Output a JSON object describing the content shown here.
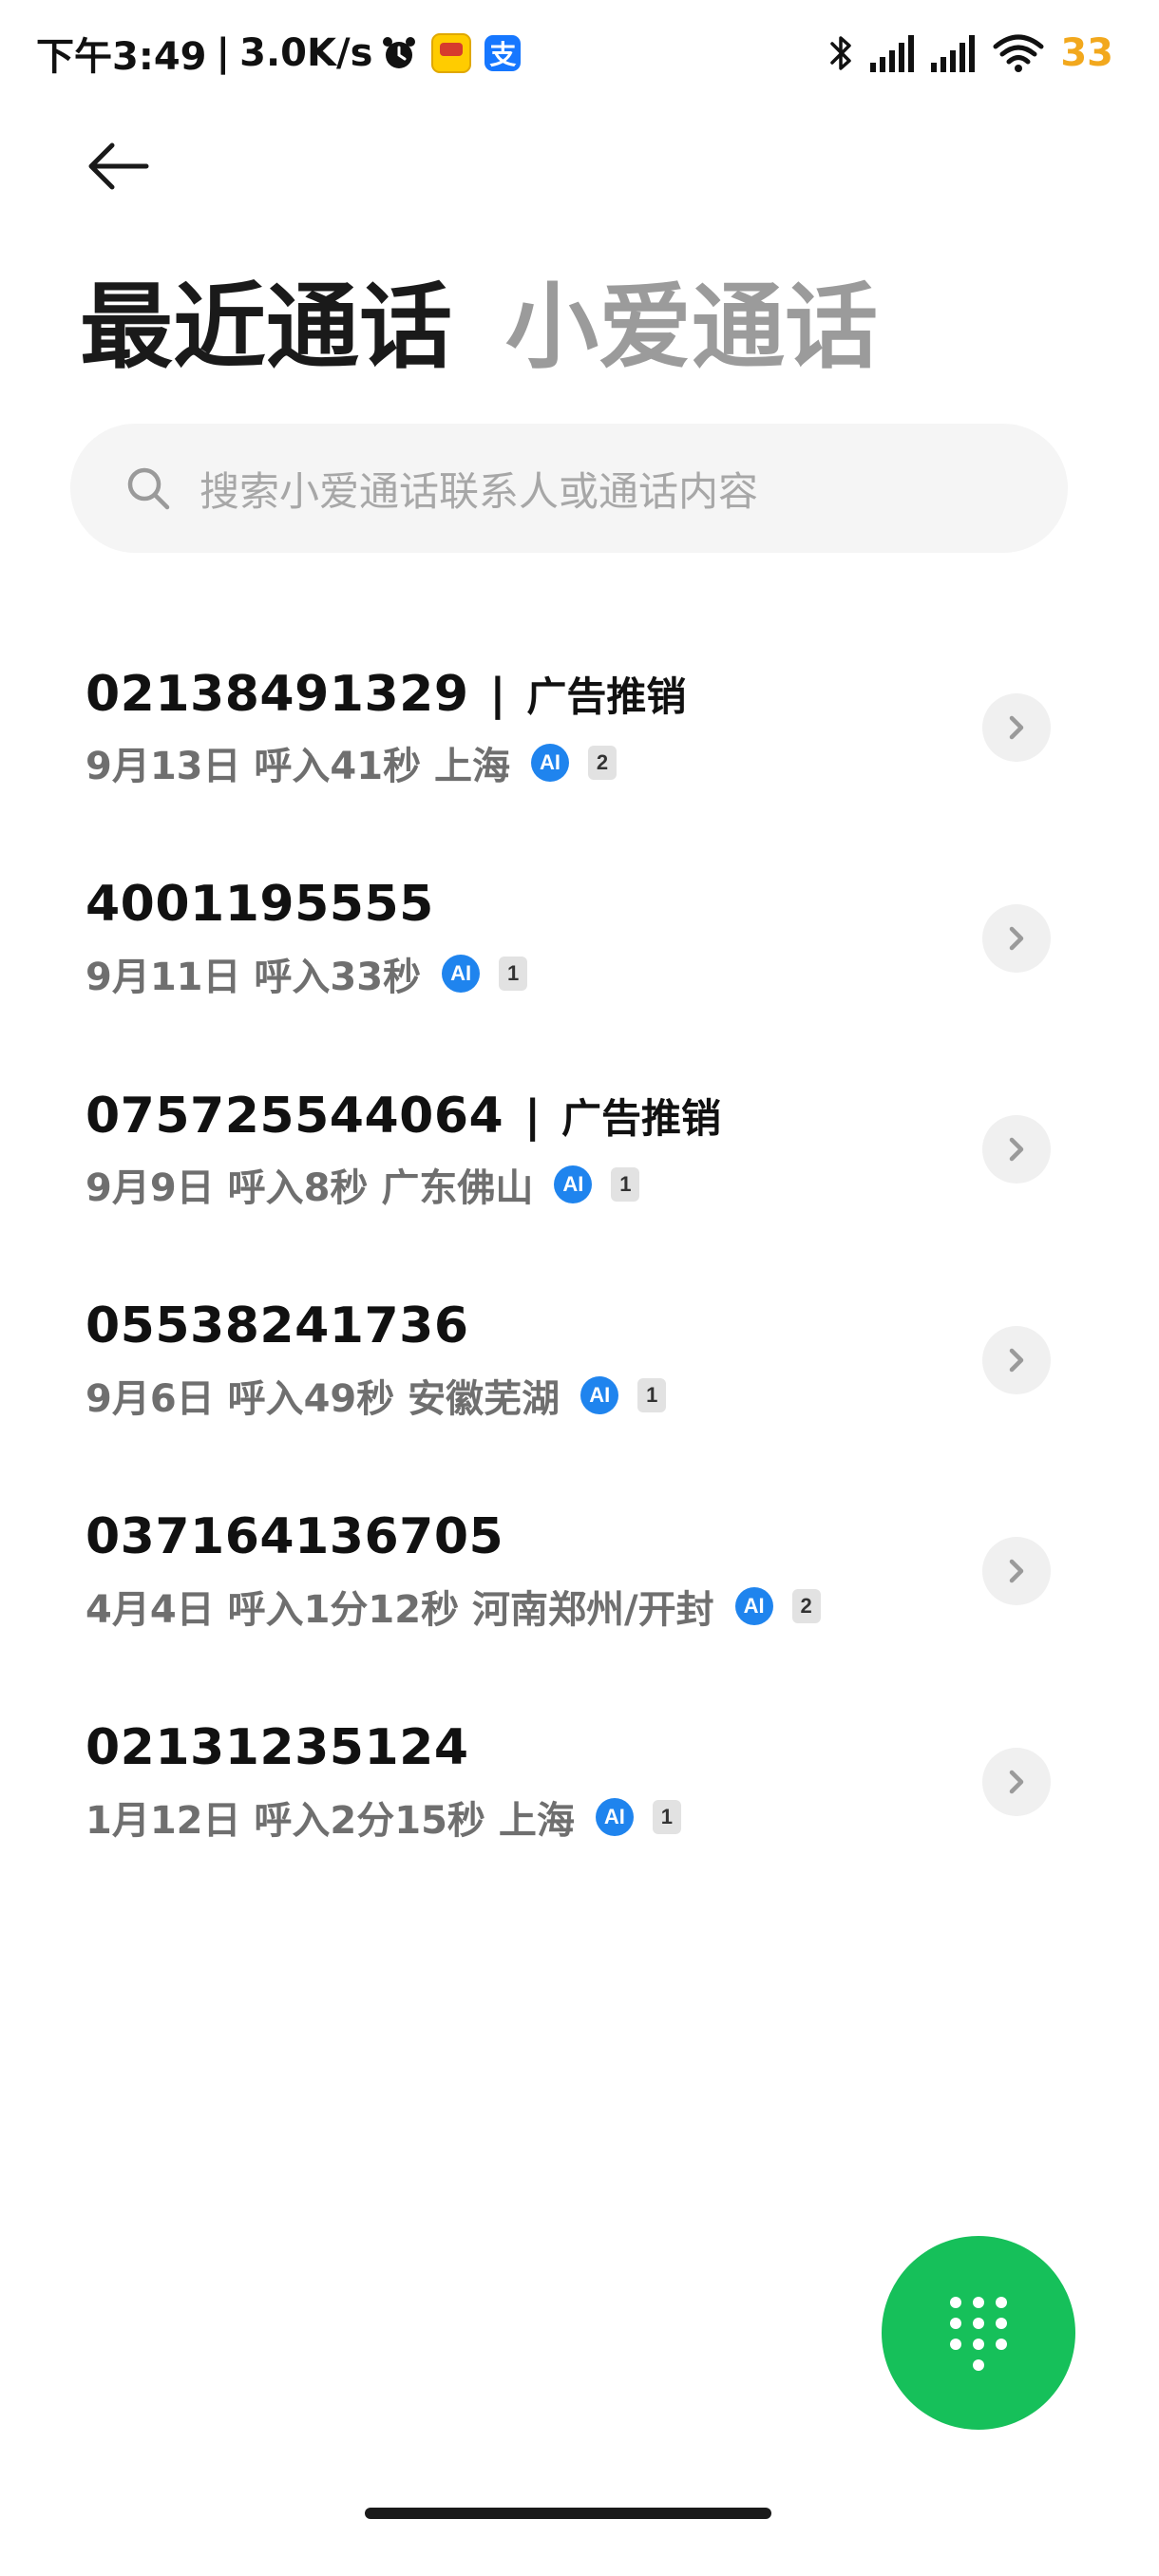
{
  "status_bar": {
    "time": "下午3:49",
    "separator": "|",
    "network_speed": "3.0K/s",
    "battery": "33"
  },
  "header": {
    "tabs": [
      {
        "label": "最近通话",
        "active": true
      },
      {
        "label": "小爱通话",
        "active": false
      }
    ]
  },
  "search": {
    "placeholder": "搜索小爱通话联系人或通话内容"
  },
  "calls": [
    {
      "number": "02138491329",
      "divider": "|",
      "tag": "广告推销",
      "meta": "9月13日 呼入41秒 上海",
      "ai": "AI",
      "count": "2"
    },
    {
      "number": "4001195555",
      "divider": "",
      "tag": "",
      "meta": "9月11日 呼入33秒",
      "ai": "AI",
      "count": "1"
    },
    {
      "number": "075725544064",
      "divider": "|",
      "tag": "广告推销",
      "meta": "9月9日 呼入8秒 广东佛山",
      "ai": "AI",
      "count": "1"
    },
    {
      "number": "05538241736",
      "divider": "",
      "tag": "",
      "meta": "9月6日 呼入49秒 安徽芜湖",
      "ai": "AI",
      "count": "1"
    },
    {
      "number": "037164136705",
      "divider": "",
      "tag": "",
      "meta": "4月4日 呼入1分12秒 河南郑州/开封",
      "ai": "AI",
      "count": "2"
    },
    {
      "number": "02131235124",
      "divider": "",
      "tag": "",
      "meta": "1月12日 呼入2分15秒 上海",
      "ai": "AI",
      "count": "1"
    }
  ],
  "colors": {
    "fab": "#16c05a",
    "ai_badge": "#1f84ee",
    "battery": "#f2a81d",
    "inactive_tab": "#9b9b9b"
  },
  "icons": {
    "back": "arrow-left-icon",
    "search": "search-icon",
    "chevron": "chevron-right-icon",
    "dialpad": "dialpad-icon"
  }
}
